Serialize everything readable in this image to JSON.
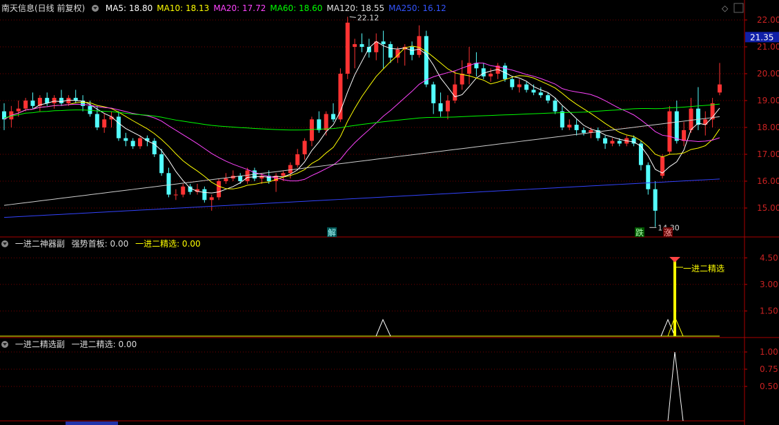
{
  "main_header": {
    "stock": "南天信息(日线 前复权)",
    "ma": [
      {
        "label": "MA5: 18.80",
        "color": "#ffffff"
      },
      {
        "label": "MA10: 18.13",
        "color": "#ffff00"
      },
      {
        "label": "MA20: 17.72",
        "color": "#ff44ff"
      },
      {
        "label": "MA60: 18.60",
        "color": "#00ff00"
      },
      {
        "label": "MA120: 18.55",
        "color": "#e0e0e0"
      },
      {
        "label": "MA250: 16.12",
        "color": "#3355ff"
      }
    ]
  },
  "y_axis_main": [
    "22.00",
    "21.00",
    "20.00",
    "19.00",
    "18.00",
    "17.00",
    "16.00",
    "15.00"
  ],
  "price_tag": "21.35",
  "max_label": "22.12",
  "min_label": "14.30",
  "markers": {
    "jie": "解",
    "die": "跌",
    "zhang": "涨"
  },
  "sub1": {
    "title": "一进二神器副",
    "f1_label": "强势首板: 0.00",
    "f2_label": "一进二精选: 0.00",
    "annotation": "一进二精选",
    "y_axis": [
      "4.50",
      "3.00",
      "1.50"
    ]
  },
  "sub2": {
    "title": "一进二精选副",
    "f1_label": "一进二精选: 0.00",
    "y_axis": [
      "1.00",
      "0.75",
      "0.50"
    ]
  },
  "icons": {
    "diamond": "diamond-icon",
    "arrows": "arrow-icon"
  },
  "chart_data": {
    "type": "candlestick",
    "y_range": [
      14.3,
      22.12
    ],
    "candles": [
      [
        18.6,
        18.9,
        17.9,
        18.3
      ],
      [
        18.3,
        18.8,
        18.0,
        18.6
      ],
      [
        18.6,
        19.0,
        18.4,
        18.7
      ],
      [
        18.7,
        19.1,
        18.6,
        19.0
      ],
      [
        19.0,
        19.3,
        18.7,
        18.8
      ],
      [
        18.8,
        19.2,
        18.6,
        19.1
      ],
      [
        19.1,
        19.3,
        18.8,
        18.9
      ],
      [
        18.9,
        19.2,
        18.7,
        19.1
      ],
      [
        19.1,
        19.4,
        18.8,
        18.9
      ],
      [
        18.9,
        19.2,
        18.8,
        19.1
      ],
      [
        19.1,
        19.4,
        18.9,
        19.0
      ],
      [
        19.0,
        19.2,
        18.6,
        18.8
      ],
      [
        18.8,
        19.0,
        18.4,
        18.5
      ],
      [
        18.5,
        18.8,
        17.9,
        18.0
      ],
      [
        18.0,
        18.5,
        17.8,
        18.3
      ],
      [
        18.3,
        18.6,
        18.0,
        18.4
      ],
      [
        18.4,
        18.6,
        17.5,
        17.6
      ],
      [
        17.6,
        17.8,
        17.3,
        17.5
      ],
      [
        17.5,
        17.6,
        17.2,
        17.3
      ],
      [
        17.3,
        17.7,
        17.2,
        17.6
      ],
      [
        17.6,
        17.7,
        17.3,
        17.5
      ],
      [
        17.5,
        17.6,
        16.9,
        17.0
      ],
      [
        17.0,
        17.2,
        16.2,
        16.3
      ],
      [
        16.3,
        16.5,
        15.4,
        15.5
      ],
      [
        15.5,
        15.7,
        15.3,
        15.5
      ],
      [
        15.5,
        15.9,
        15.4,
        15.8
      ],
      [
        15.8,
        15.9,
        15.5,
        15.6
      ],
      [
        15.6,
        15.9,
        15.5,
        15.7
      ],
      [
        15.7,
        15.8,
        15.2,
        15.3
      ],
      [
        15.3,
        15.5,
        14.9,
        15.4
      ],
      [
        15.4,
        16.1,
        15.3,
        16.0
      ],
      [
        16.0,
        16.3,
        15.9,
        16.1
      ],
      [
        16.1,
        16.4,
        16.0,
        16.2
      ],
      [
        16.2,
        16.3,
        15.9,
        16.0
      ],
      [
        16.0,
        16.5,
        15.9,
        16.4
      ],
      [
        16.4,
        16.5,
        16.0,
        16.1
      ],
      [
        16.1,
        16.3,
        15.9,
        16.2
      ],
      [
        16.2,
        16.4,
        15.9,
        16.0
      ],
      [
        16.0,
        16.3,
        15.6,
        16.2
      ],
      [
        16.2,
        16.4,
        16.0,
        16.3
      ],
      [
        16.3,
        16.7,
        16.1,
        16.6
      ],
      [
        16.6,
        17.2,
        16.5,
        17.0
      ],
      [
        17.0,
        17.6,
        16.8,
        17.5
      ],
      [
        17.5,
        18.4,
        17.3,
        18.3
      ],
      [
        18.3,
        18.6,
        17.8,
        17.9
      ],
      [
        17.9,
        18.6,
        17.7,
        18.5
      ],
      [
        18.5,
        18.9,
        18.2,
        18.3
      ],
      [
        18.3,
        20.2,
        18.2,
        20.0
      ],
      [
        20.0,
        22.12,
        19.8,
        21.9
      ],
      [
        21.0,
        21.3,
        20.2,
        21.1
      ],
      [
        21.1,
        21.5,
        20.8,
        21.0
      ],
      [
        21.0,
        21.3,
        20.6,
        20.8
      ],
      [
        20.8,
        21.5,
        20.5,
        21.2
      ],
      [
        21.2,
        21.6,
        20.2,
        21.1
      ],
      [
        21.1,
        21.2,
        20.4,
        20.6
      ],
      [
        20.6,
        21.0,
        20.4,
        20.9
      ],
      [
        20.9,
        21.1,
        20.3,
        21.0
      ],
      [
        21.0,
        21.2,
        20.5,
        20.7
      ],
      [
        20.7,
        21.8,
        20.6,
        21.4
      ],
      [
        21.4,
        21.6,
        19.5,
        19.6
      ],
      [
        19.6,
        19.7,
        18.5,
        18.9
      ],
      [
        18.9,
        19.3,
        18.4,
        18.6
      ],
      [
        18.6,
        19.2,
        18.3,
        19.0
      ],
      [
        19.0,
        20.1,
        18.9,
        19.6
      ],
      [
        19.6,
        20.5,
        19.4,
        20.0
      ],
      [
        20.0,
        21.0,
        19.6,
        20.4
      ],
      [
        20.4,
        20.8,
        19.9,
        20.2
      ],
      [
        20.2,
        20.4,
        19.8,
        19.9
      ],
      [
        19.9,
        20.2,
        19.7,
        20.0
      ],
      [
        20.0,
        20.4,
        19.8,
        20.3
      ],
      [
        20.3,
        20.4,
        19.7,
        19.8
      ],
      [
        19.8,
        19.9,
        19.4,
        19.5
      ],
      [
        19.5,
        19.8,
        19.3,
        19.6
      ],
      [
        19.6,
        19.7,
        19.3,
        19.4
      ],
      [
        19.4,
        19.6,
        19.2,
        19.3
      ],
      [
        19.3,
        19.5,
        19.1,
        19.2
      ],
      [
        19.2,
        19.3,
        18.9,
        19.0
      ],
      [
        19.0,
        19.1,
        18.5,
        18.6
      ],
      [
        18.6,
        18.8,
        17.9,
        18.0
      ],
      [
        18.0,
        18.3,
        17.9,
        18.1
      ],
      [
        18.1,
        18.3,
        17.7,
        17.9
      ],
      [
        17.9,
        18.0,
        17.7,
        17.8
      ],
      [
        17.8,
        18.0,
        17.6,
        17.9
      ],
      [
        17.9,
        18.0,
        17.5,
        17.6
      ],
      [
        17.6,
        17.7,
        17.2,
        17.4
      ],
      [
        17.4,
        17.6,
        17.3,
        17.5
      ],
      [
        17.5,
        17.6,
        17.3,
        17.4
      ],
      [
        17.4,
        17.7,
        17.3,
        17.6
      ],
      [
        17.6,
        17.7,
        17.3,
        17.4
      ],
      [
        17.4,
        17.5,
        16.4,
        16.6
      ],
      [
        16.6,
        16.7,
        15.5,
        15.7
      ],
      [
        15.7,
        16.0,
        14.3,
        14.9
      ],
      [
        16.2,
        17.0,
        16.1,
        16.9
      ],
      [
        17.1,
        18.8,
        17.0,
        18.6
      ],
      [
        18.6,
        19.0,
        17.4,
        17.5
      ],
      [
        17.5,
        18.2,
        17.3,
        17.9
      ],
      [
        17.9,
        19.1,
        17.8,
        18.7
      ],
      [
        18.7,
        19.5,
        17.9,
        18.1
      ],
      [
        18.1,
        18.6,
        17.7,
        18.3
      ],
      [
        18.3,
        19.1,
        18.0,
        18.9
      ],
      [
        19.3,
        20.4,
        19.2,
        19.6
      ]
    ]
  }
}
